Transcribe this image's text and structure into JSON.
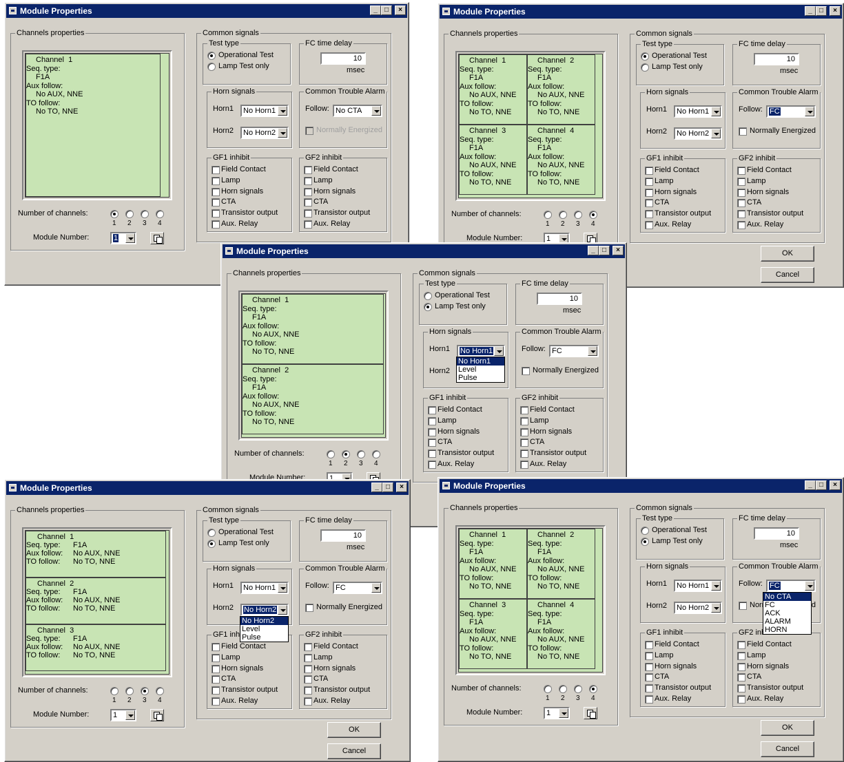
{
  "windows": [
    {
      "title": "Module Properties",
      "test_type": "operational",
      "follow_value": "No CTA",
      "follow_selected": false,
      "normally_energized_disabled": true,
      "channels_selected": 1,
      "module_number_selected": true,
      "has_buttons": false,
      "dropdown": null
    },
    {
      "title": "Module Properties",
      "test_type": "operational",
      "follow_value": "FC",
      "follow_selected": true,
      "normally_energized_disabled": false,
      "channels_selected": 4,
      "module_number_selected": false,
      "has_buttons": true,
      "dropdown": null
    },
    {
      "title": "Module Properties",
      "test_type": "lamp",
      "follow_value": "FC",
      "follow_selected": false,
      "normally_energized_disabled": false,
      "channels_selected": 2,
      "module_number_selected": false,
      "has_buttons": false,
      "dropdown": "horn1"
    },
    {
      "title": "Module Properties",
      "test_type": "lamp",
      "follow_value": "FC",
      "follow_selected": false,
      "normally_energized_disabled": false,
      "channels_selected": 3,
      "module_number_selected": false,
      "has_buttons": true,
      "dropdown": "horn2"
    },
    {
      "title": "Module Properties",
      "test_type": "lamp",
      "follow_value": "FC",
      "follow_selected": true,
      "normally_energized_disabled": false,
      "channels_selected": 4,
      "module_number_selected": false,
      "has_buttons": true,
      "dropdown": "follow"
    }
  ],
  "labels": {
    "channels_properties": "Channels properties",
    "common_signals": "Common signals",
    "test_type": "Test type",
    "operational_test": "Operational Test",
    "lamp_test_only": "Lamp Test only",
    "fc_time_delay": "FC time delay",
    "fc_delay_value": "10",
    "msec": "msec",
    "horn_signals": "Horn signals",
    "horn1": "Horn1",
    "horn2": "Horn2",
    "horn1_value": "No Horn1",
    "horn2_value": "No Horn2",
    "common_trouble_alarm": "Common Trouble Alarm",
    "follow": "Follow:",
    "normally_energized": "Normally Energized",
    "gf1_inhibit": "GF1 inhibit",
    "gf2_inhibit": "GF2 inhibit",
    "inhibit_items": [
      "Field Contact",
      "Lamp",
      "Horn signals",
      "CTA",
      "Transistor output",
      "Aux. Relay"
    ],
    "number_of_channels": "Number of channels:",
    "channel_numbers": [
      "1",
      "2",
      "3",
      "4"
    ],
    "module_number": "Module Number:",
    "module_number_value": "1",
    "ok": "OK",
    "cancel": "Cancel"
  },
  "channels": [
    {
      "name": "Channel  1",
      "seq_type_label": "Seq. type:",
      "seq_type": "F1A",
      "aux_label": "Aux follow:",
      "aux": "No AUX, NNE",
      "to_label": "TO follow:",
      "to": "No TO, NNE"
    },
    {
      "name": "Channel  2",
      "seq_type_label": "Seq. type:",
      "seq_type": "F1A",
      "aux_label": "Aux follow:",
      "aux": "No AUX, NNE",
      "to_label": "TO follow:",
      "to": "No TO, NNE"
    },
    {
      "name": "Channel  3",
      "seq_type_label": "Seq. type:",
      "seq_type": "F1A",
      "aux_label": "Aux follow:",
      "aux": "No AUX, NNE",
      "to_label": "TO follow:",
      "to": "No TO, NNE"
    },
    {
      "name": "Channel  4",
      "seq_type_label": "Seq. type:",
      "seq_type": "F1A",
      "aux_label": "Aux follow:",
      "aux": "No AUX, NNE",
      "to_label": "TO follow:",
      "to": "No TO, NNE"
    }
  ],
  "dropdowns": {
    "horn1": [
      "No Horn1",
      "Level",
      "Pulse"
    ],
    "horn2": [
      "No Horn2",
      "Level",
      "Pulse"
    ],
    "follow": [
      "No CTA",
      "FC",
      "ACK",
      "ALARM",
      "HORN"
    ]
  },
  "colors": {
    "title_bar": "#0a246a",
    "dialog_face": "#d4d0c8",
    "channel_green": "#c8e4b4"
  }
}
